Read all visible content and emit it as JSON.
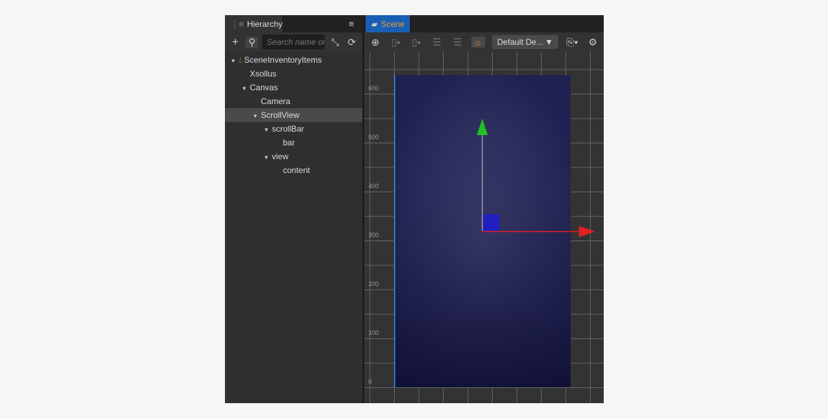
{
  "hierarchy": {
    "title": "Hierarchy",
    "search_placeholder": "Search name or uuid",
    "items": [
      {
        "label": "SceneInventoryItems",
        "depth": 0,
        "expanded": true,
        "icon": "flame-icon"
      },
      {
        "label": "Xsollus",
        "depth": 1
      },
      {
        "label": "Canvas",
        "depth": 1,
        "expanded": true
      },
      {
        "label": "Camera",
        "depth": 2
      },
      {
        "label": "ScrollView",
        "depth": 2,
        "expanded": true,
        "selected": true
      },
      {
        "label": "scrollBar",
        "depth": 3,
        "expanded": true
      },
      {
        "label": "bar",
        "depth": 4
      },
      {
        "label": "view",
        "depth": 3,
        "expanded": true
      },
      {
        "label": "content",
        "depth": 4
      }
    ]
  },
  "scene": {
    "title": "Scene",
    "device": "Default De...",
    "ruler": [
      "600",
      "500",
      "400",
      "300",
      "200",
      "100",
      "0"
    ]
  },
  "colors": {
    "accent": "#1a5fb4",
    "tab_text": "#f0a030",
    "canvas": "#22245a"
  }
}
